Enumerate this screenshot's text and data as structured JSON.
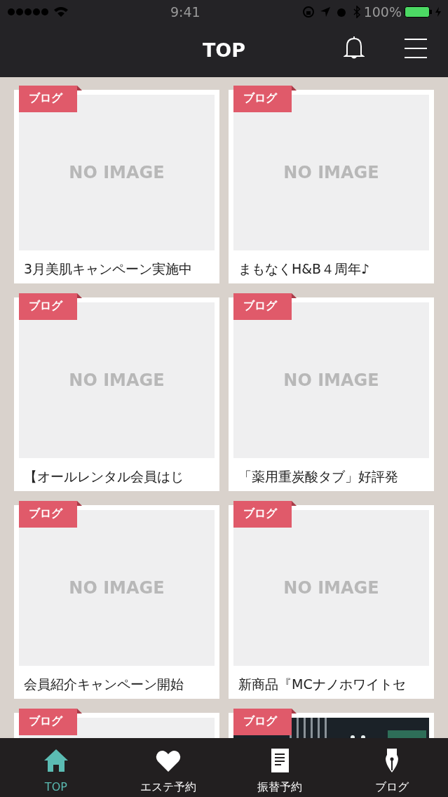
{
  "status_bar": {
    "time": "9:41",
    "battery": "100%"
  },
  "header": {
    "title": "TOP"
  },
  "posts": [
    {
      "tag": "ブログ",
      "image": {
        "kind": "placeholder",
        "text": "NO IMAGE"
      },
      "title": "3月美肌キャンペーン実施中"
    },
    {
      "tag": "ブログ",
      "image": {
        "kind": "placeholder",
        "text": "NO IMAGE"
      },
      "title": "まもなくH&B４周年♪"
    },
    {
      "tag": "ブログ",
      "image": {
        "kind": "placeholder",
        "text": "NO IMAGE"
      },
      "title": "【オールレンタル会員はじ"
    },
    {
      "tag": "ブログ",
      "image": {
        "kind": "placeholder",
        "text": "NO IMAGE"
      },
      "title": "「薬用重炭酸タブ」好評発"
    },
    {
      "tag": "ブログ",
      "image": {
        "kind": "placeholder",
        "text": "NO IMAGE"
      },
      "title": "会員紹介キャンペーン開始"
    },
    {
      "tag": "ブログ",
      "image": {
        "kind": "placeholder",
        "text": "NO IMAGE"
      },
      "title": "新商品『MCナノホワイトセ"
    },
    {
      "tag": "ブログ",
      "image": {
        "kind": "placeholder"
      }
    },
    {
      "tag": "ブログ"
    }
  ],
  "tab_bar": [
    {
      "label": "TOP",
      "selected": true
    },
    {
      "label": "エステ予約",
      "selected": false
    },
    {
      "label": "振替予約",
      "selected": false
    },
    {
      "label": "ブログ",
      "selected": false
    }
  ]
}
